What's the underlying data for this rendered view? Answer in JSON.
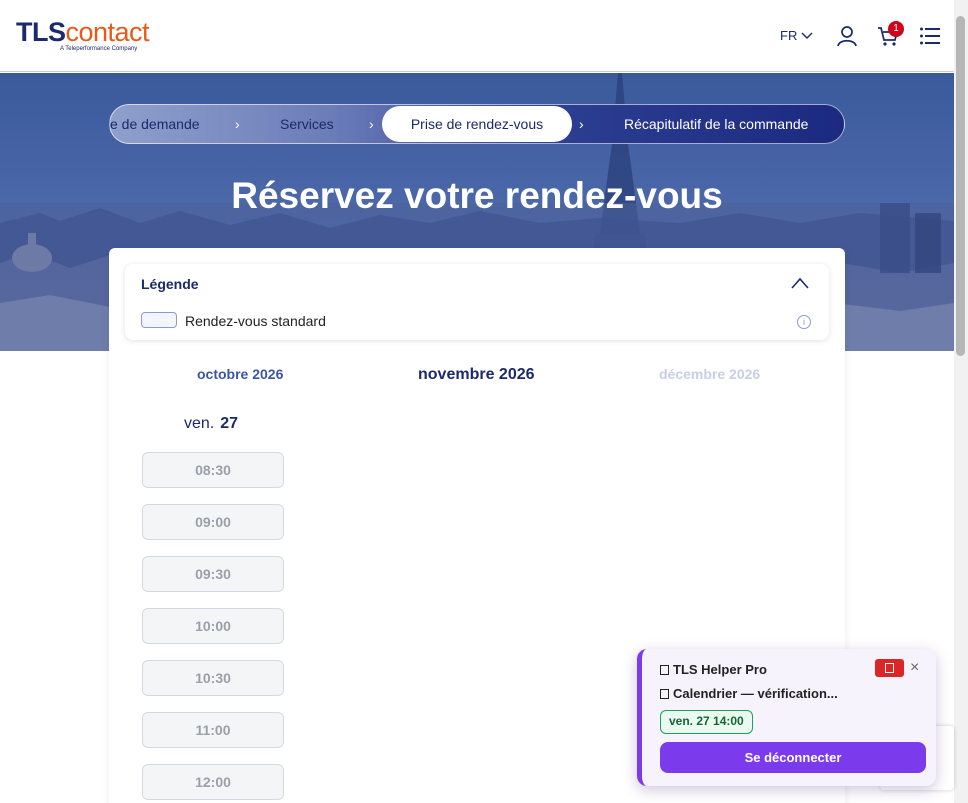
{
  "header": {
    "logo_tls": "TLS",
    "logo_contact": "contact",
    "logo_tagline": "A Teleperformance Company",
    "language": "FR",
    "cart_count": "1",
    "icons": [
      "user-icon",
      "cart-icon",
      "menu-icon"
    ]
  },
  "stepper": {
    "steps": [
      "e de demande",
      "Services",
      "Prise de rendez-vous",
      "Récapitulatif de la commande"
    ],
    "active_index": 2
  },
  "hero": {
    "title": "Réservez votre rendez-vous"
  },
  "legend": {
    "title": "Légende",
    "item_label": "Rendez-vous standard"
  },
  "calendar": {
    "prev_month": "octobre 2026",
    "current_month": "novembre 2026",
    "next_month": "décembre 2026",
    "day_name": "ven.",
    "day_number": "27",
    "slots": [
      "08:30",
      "09:00",
      "09:30",
      "10:00",
      "10:30",
      "11:00",
      "12:00"
    ]
  },
  "helper": {
    "title": "TLS Helper Pro",
    "status": "Calendrier — vérification...",
    "found_slot": "ven. 27 14:00",
    "logout_label": "Se déconnecter",
    "close_label": "×"
  },
  "colors": {
    "brand_navy": "#1b2a6b",
    "brand_orange": "#e8591a",
    "accent_purple": "#7c3aed",
    "success_green": "#22a05a",
    "alert_red": "#dc2626"
  }
}
